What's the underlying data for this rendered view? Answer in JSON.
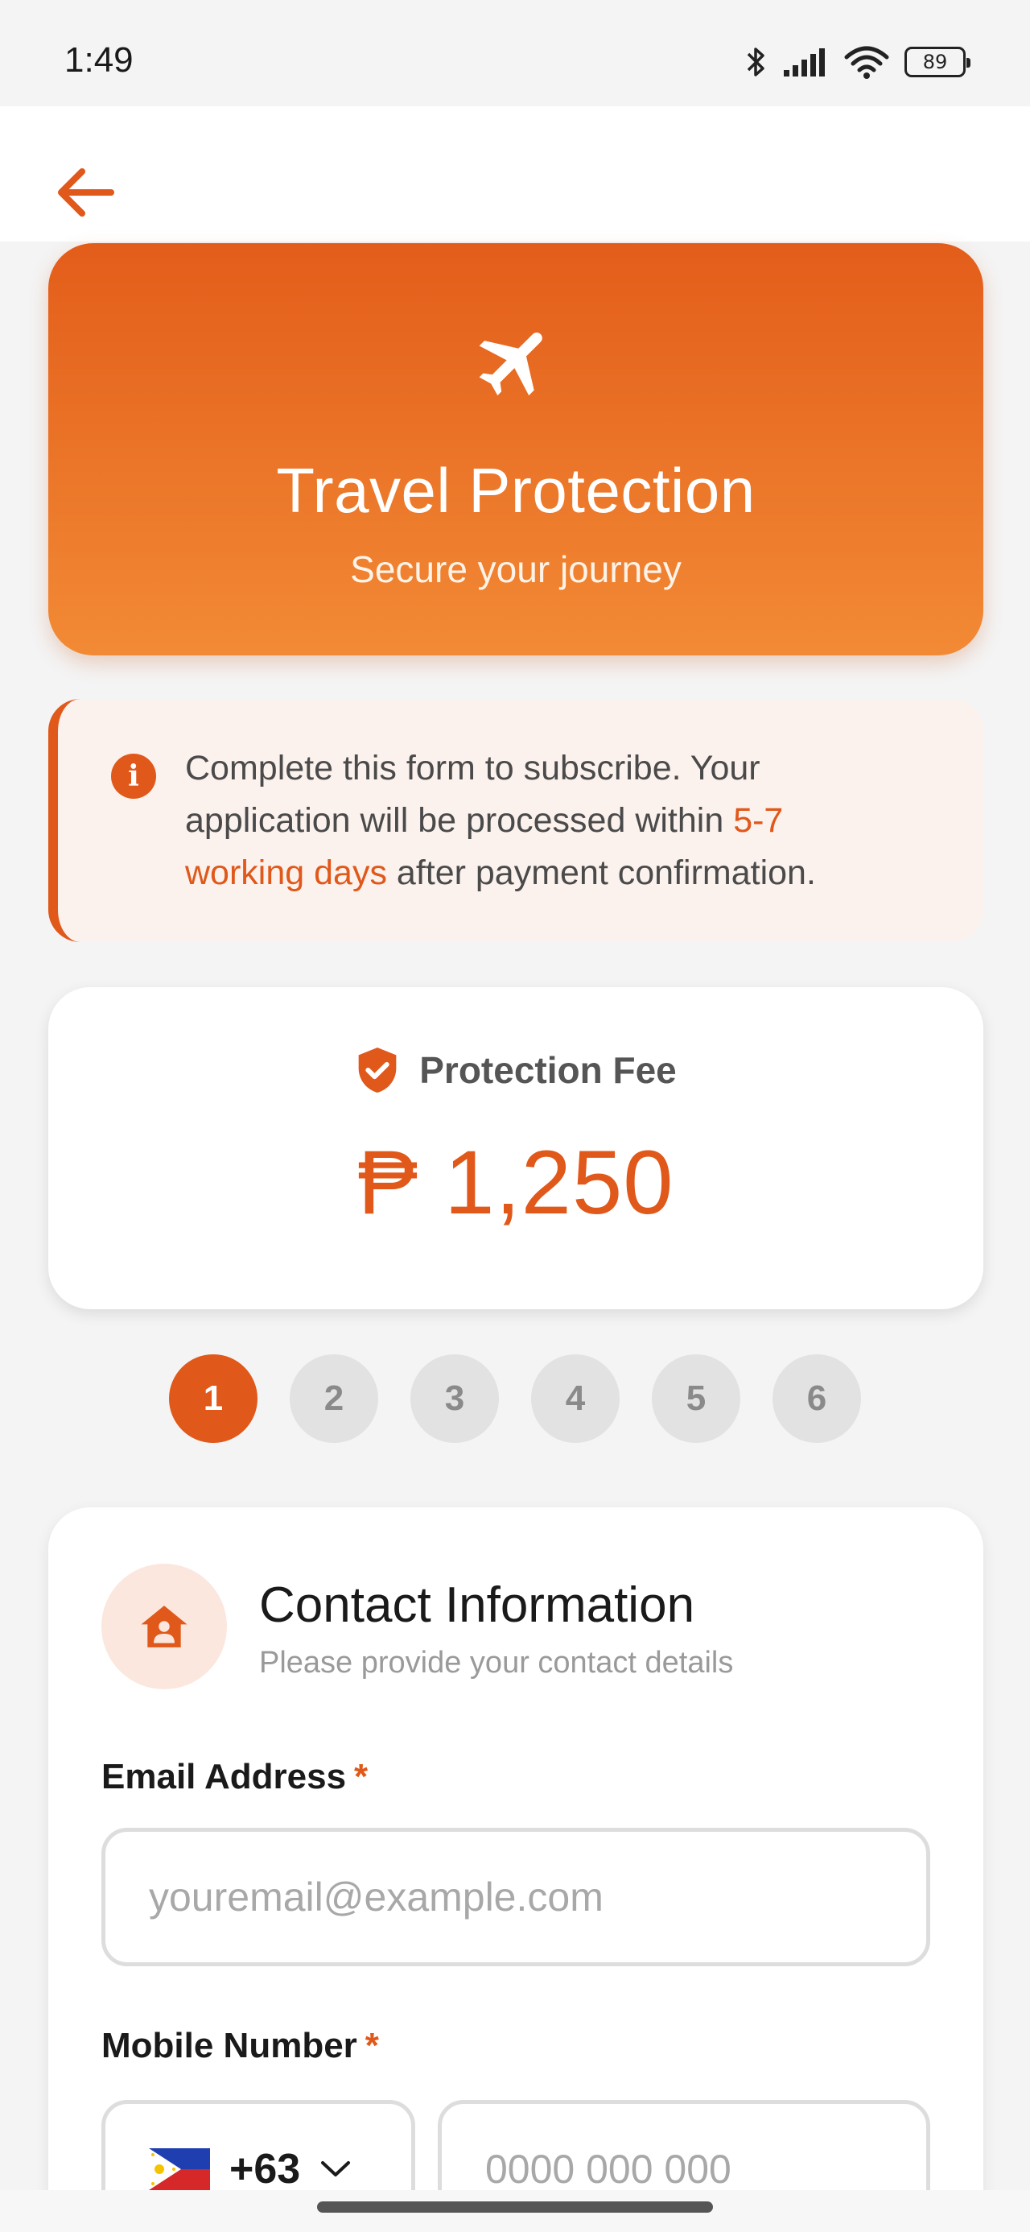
{
  "status_bar": {
    "time": "1:49",
    "battery": "89"
  },
  "header": {
    "back_icon": "arrow-left-icon"
  },
  "hero": {
    "icon": "airplane-icon",
    "title": "Travel Protection",
    "subtitle": "Secure your journey"
  },
  "info": {
    "icon": "info-icon",
    "text_before": "Complete this form to subscribe. Your application will be processed within ",
    "highlight": "5-7 working days",
    "text_after": " after payment confirmation."
  },
  "fee": {
    "icon": "shield-check-icon",
    "label": "Protection Fee",
    "amount": "₱ 1,250"
  },
  "steps": {
    "current": 1,
    "items": [
      "1",
      "2",
      "3",
      "4",
      "5",
      "6"
    ]
  },
  "contact_section": {
    "icon": "contact-home-icon",
    "title": "Contact Information",
    "subtitle": "Please provide your contact details",
    "email": {
      "label": "Email Address",
      "required_mark": "*",
      "placeholder": "youremail@example.com",
      "value": ""
    },
    "mobile": {
      "label": "Mobile Number",
      "required_mark": "*",
      "country_flag": "philippines-flag-icon",
      "country_code": "+63",
      "placeholder": "0000 000 000",
      "value": ""
    }
  },
  "colors": {
    "accent": "#e0581a",
    "accent_light": "#f28a35",
    "background": "#f4f4f4"
  }
}
